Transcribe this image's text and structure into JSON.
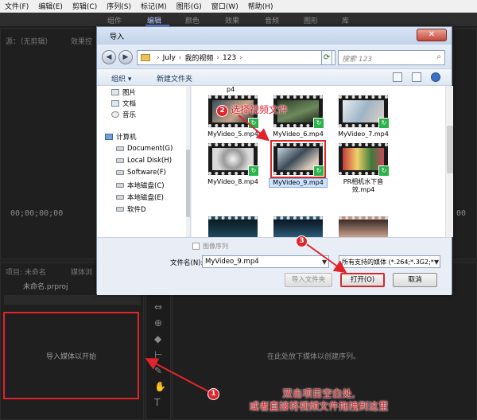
{
  "menu": [
    "文件(F)",
    "编辑(E)",
    "剪辑(C)",
    "序列(S)",
    "标记(M)",
    "图形(G)",
    "窗口(W)",
    "帮助(H)"
  ],
  "workspace_tabs": [
    "组件",
    "编辑",
    "颜色",
    "效果",
    "音频",
    "图形",
    "库"
  ],
  "source_panel": {
    "tab": "源：（无剪辑）",
    "tab2": "效果控"
  },
  "timecodes": {
    "left": "00;00;00;00",
    "right": "00"
  },
  "project_panel": {
    "tab": "项目: 未命名",
    "tab2": "媒体浏",
    "file": "未命名.prproj",
    "import_hint": "导入媒体以开始"
  },
  "timeline_hint": "在此处放下媒体以创建序列。",
  "dialog": {
    "title": "导入",
    "close": "✕",
    "path": [
      "July",
      "我的视频",
      "123"
    ],
    "search_placeholder": "搜索 123",
    "organize": "组织 ▾",
    "new_folder": "新建文件夹",
    "nav_items": [
      "图片",
      "文档",
      "音乐",
      "计算机",
      "Document(G)",
      "Local Disk(H)",
      "Software(F)",
      "本地磁盘(C)",
      "本地磁盘(E)",
      "软件D"
    ],
    "files": [
      {
        "name": "MyVideo_5.mp4",
        "scene": "hands"
      },
      {
        "name": "MyVideo_6.mp4",
        "scene": "forest"
      },
      {
        "name": "MyVideo_7.mp4",
        "scene": "portrait"
      },
      {
        "name": "MyVideo_8.mp4",
        "scene": "sketch"
      },
      {
        "name": "MyVideo_9.mp4",
        "scene": "guitar",
        "selected": true
      },
      {
        "name": "PR相机水下音效.mp4",
        "scene": "flowers"
      }
    ],
    "partial_top": "p4",
    "image_sequence": "图像序列",
    "filename_label": "文件名(N):",
    "filename_value": "MyVideo_9.mp4",
    "filter": "所有支持的媒体 (*.264;*.3G2;*",
    "btn_import_folder": "导入文件夹",
    "btn_open": "打开(O)",
    "btn_cancel": "取消"
  },
  "annotations": {
    "step1_num": "1",
    "step1_text": [
      "双击项目空白处,",
      "或者直接将视频文件拖拽到这里"
    ],
    "step2_num": "2",
    "step2_text": "选择视频文件",
    "step3_num": "3"
  },
  "colors": {
    "annotation_red": "#e0242b",
    "premiere_bg": "#232323",
    "dialog_bg": "#e9eef6"
  }
}
